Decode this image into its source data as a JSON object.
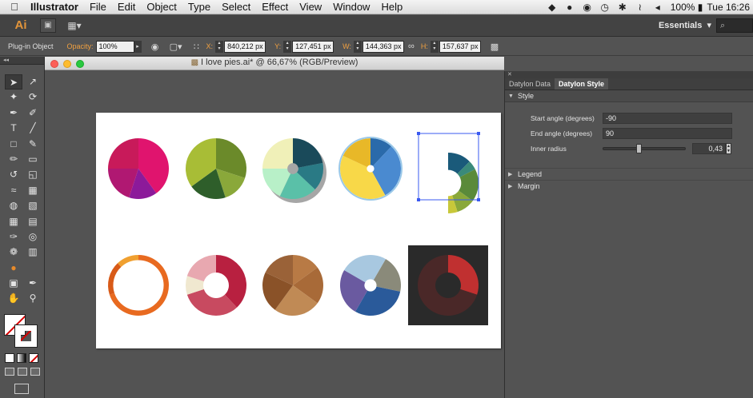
{
  "menubar": {
    "app_name": "Illustrator",
    "items": [
      "File",
      "Edit",
      "Object",
      "Type",
      "Select",
      "Effect",
      "View",
      "Window",
      "Help"
    ],
    "battery": "100%",
    "clock": "Tue 16:26"
  },
  "appbar": {
    "logo": "Ai",
    "workspace": "Essentials",
    "search_placeholder": "⌕"
  },
  "control": {
    "object_type": "Plug-in Object",
    "opacity_label": "Opacity:",
    "opacity_value": "100%",
    "x_label": "X:",
    "x_value": "840,212 px",
    "y_label": "Y:",
    "y_value": "127,451 px",
    "w_label": "W:",
    "w_value": "144,363 px",
    "h_label": "H:",
    "h_value": "157,637 px"
  },
  "document": {
    "title": "I love pies.ai* @ 66,67% (RGB/Preview)"
  },
  "panel": {
    "tabs": [
      "Datylon Data",
      "Datylon Style"
    ],
    "active_tab": 1,
    "section_style": "Style",
    "start_angle_label": "Start angle (degrees)",
    "start_angle_value": "-90",
    "end_angle_label": "End angle (degrees)",
    "end_angle_value": "90",
    "inner_radius_label": "Inner radius",
    "inner_radius_value": "0,43",
    "inner_radius_fraction": 0.43,
    "section_legend": "Legend",
    "section_margin": "Margin"
  },
  "chart_data": [
    {
      "type": "pie",
      "values": [
        40,
        15,
        20,
        25
      ],
      "colors": [
        "#e0146e",
        "#8c1a9a",
        "#b01872",
        "#c81a5a"
      ],
      "inner": 0,
      "start": -90,
      "end": 270
    },
    {
      "type": "pie",
      "values": [
        30,
        15,
        20,
        35
      ],
      "colors": [
        "#6b8a2a",
        "#8aa83a",
        "#2e5e2a",
        "#a8bd36"
      ],
      "inner": 0,
      "start": -90,
      "end": 270
    },
    {
      "type": "pie",
      "values": [
        22,
        15,
        20,
        18,
        25
      ],
      "colors": [
        "#1a4a5a",
        "#2a7a85",
        "#5ac0a8",
        "#b8f0c8",
        "#f0f0b8"
      ],
      "inner": 0.18,
      "start": -90,
      "end": 270
    },
    {
      "type": "pie",
      "values": [
        12,
        30,
        40,
        18
      ],
      "colors": [
        "#2a6aaa",
        "#4a8ad0",
        "#f8d848",
        "#e8b828"
      ],
      "inner": 0.12,
      "start": -90,
      "end": 270
    },
    {
      "type": "pie",
      "values": [
        25,
        10,
        35,
        20,
        10
      ],
      "colors": [
        "#1a5a7a",
        "#3a8a7a",
        "#5a8a3a",
        "#8aa83a",
        "#c8c83a"
      ],
      "inner": 0.43,
      "start": -90,
      "end": 90
    },
    {
      "type": "pie",
      "values": [
        70,
        18,
        12
      ],
      "colors": [
        "#e86a20",
        "#d85a18",
        "#f0a030"
      ],
      "inner": 0.83,
      "start": -90,
      "end": 270
    },
    {
      "type": "pie",
      "values": [
        38,
        32,
        10,
        20
      ],
      "colors": [
        "#b82040",
        "#c84a60",
        "#f0e8d0",
        "#e8a8b0"
      ],
      "inner": 0.42,
      "start": -90,
      "end": 270
    },
    {
      "type": "pie",
      "values": [
        15,
        20,
        25,
        22,
        18
      ],
      "colors": [
        "#b87a45",
        "#a86a38",
        "#c08a55",
        "#8a5228",
        "#9a6238"
      ],
      "inner": 0,
      "start": -90,
      "end": 270
    },
    {
      "type": "pie",
      "values": [
        20,
        30,
        25,
        25
      ],
      "colors": [
        "#8a8a7a",
        "#2a5a9a",
        "#6a5aa0",
        "#a8c8e0"
      ],
      "inner": 0.2,
      "start": -60,
      "end": 300
    },
    {
      "type": "pie",
      "values": [
        30,
        70
      ],
      "colors": [
        "#c03030",
        "#4a2828"
      ],
      "inner": 0.42,
      "start": -90,
      "end": 270
    }
  ]
}
